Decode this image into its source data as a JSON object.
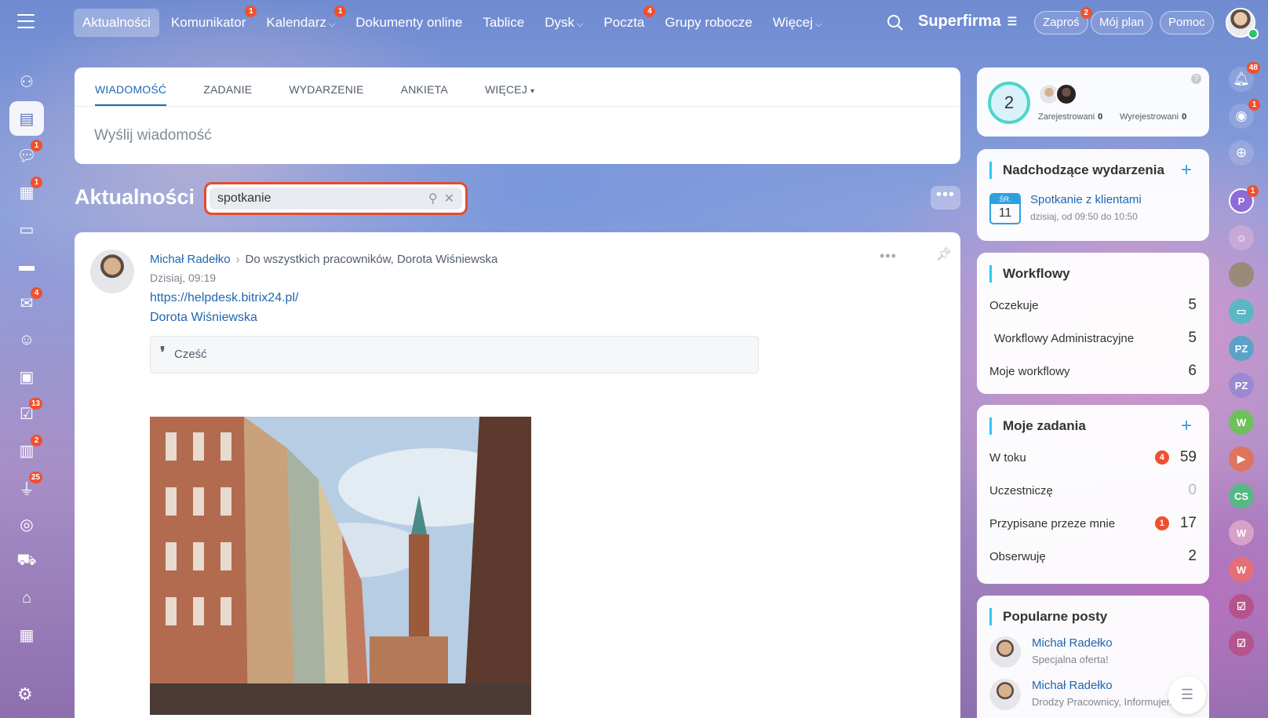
{
  "topnav": {
    "items": [
      {
        "label": "Aktualności",
        "badge": ""
      },
      {
        "label": "Komunikator",
        "badge": "1"
      },
      {
        "label": "Kalendarz",
        "badge": "1"
      },
      {
        "label": "Dokumenty online",
        "badge": ""
      },
      {
        "label": "Tablice",
        "badge": ""
      },
      {
        "label": "Dysk",
        "badge": ""
      },
      {
        "label": "Poczta",
        "badge": "4"
      },
      {
        "label": "Grupy robocze",
        "badge": ""
      },
      {
        "label": "Więcej",
        "badge": ""
      }
    ],
    "brand": "Superfirma",
    "invite_label": "Zaproś",
    "invite_badge": "2",
    "myplan_label": "Mój plan",
    "help_label": "Pomoc"
  },
  "leftbar": {
    "badges": [
      "",
      "",
      "1",
      "1",
      "",
      "",
      "4",
      "",
      "",
      "13",
      "2",
      "25",
      "",
      "",
      "",
      ""
    ]
  },
  "composer": {
    "tabs": [
      "WIADOMOŚĆ",
      "ZADANIE",
      "WYDARZENIE",
      "ANKIETA",
      "WIĘCEJ"
    ],
    "placeholder": "Wyślij wiadomość"
  },
  "page": {
    "title": "Aktualności",
    "filter_value": "spotkanie"
  },
  "post": {
    "author": "Michał Radełko",
    "recipients": "Do wszystkich pracowników, Dorota Wiśniewska",
    "date": "Dzisiaj, 09:19",
    "link": "https://helpdesk.bitrix24.pl/",
    "mention": "Dorota Wiśniewska",
    "quote": "Cześć"
  },
  "widgets": {
    "registration": {
      "count": "2",
      "registered_label": "Zarejestrowani",
      "registered_count": "0",
      "unregistered_label": "Wyrejestrowani",
      "unregistered_count": "0"
    },
    "events": {
      "title": "Nadchodzące wydarzenia",
      "day_abbr": "ŚR.",
      "day_num": "11",
      "event_title": "Spotkanie z klientami",
      "event_time": "dzisiaj, od 09:50 do 10:50"
    },
    "workflow": {
      "title": "Workflowy",
      "rows": [
        {
          "label": "Oczekuje",
          "value": "5"
        },
        {
          "label": "Workflowy Administracyjne",
          "value": "5"
        },
        {
          "label": "Moje workflowy",
          "value": "6"
        }
      ]
    },
    "tasks": {
      "title": "Moje zadania",
      "rows": [
        {
          "label": "W toku",
          "badge": "4",
          "value": "59"
        },
        {
          "label": "Uczestniczę",
          "badge": "",
          "value": "0"
        },
        {
          "label": "Przypisane przeze mnie",
          "badge": "1",
          "value": "17"
        },
        {
          "label": "Obserwuję",
          "badge": "",
          "value": "2"
        }
      ]
    },
    "popular": {
      "title": "Popularne posty",
      "items": [
        {
          "name": "Michał Radełko",
          "desc": "Specjalna oferta!"
        },
        {
          "name": "Michał Radełko",
          "desc": "Drodzy Pracownicy, Informujemy,"
        }
      ]
    }
  },
  "rail": {
    "notifications_badge": "48",
    "second_badge": "1",
    "avatar_badge": "1",
    "initials": [
      "P",
      "PZ",
      "PZ",
      "W",
      "CS",
      "W",
      "W"
    ]
  },
  "colors": {
    "accent": "#2067b0",
    "badge": "#f0502f",
    "filter_border": "#e34c2e"
  }
}
